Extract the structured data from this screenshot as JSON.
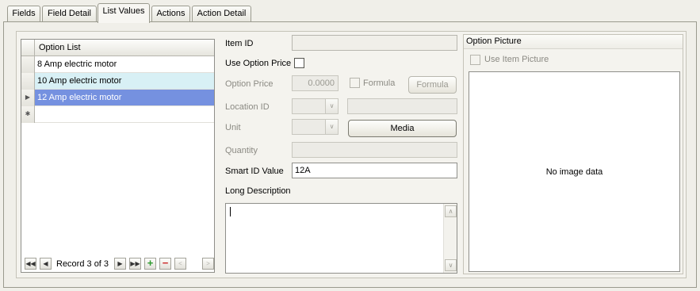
{
  "tabs": [
    {
      "label": "Fields"
    },
    {
      "label": "Field Detail"
    },
    {
      "label": "List Values"
    },
    {
      "label": "Actions"
    },
    {
      "label": "Action Detail"
    }
  ],
  "active_tab": "List Values",
  "grid": {
    "column_header": "Option List",
    "rows": [
      {
        "value": "8 Amp electric motor"
      },
      {
        "value": "10 Amp electric motor"
      },
      {
        "value": "12 Amp electric motor"
      }
    ],
    "selected_row": 3
  },
  "navigator": {
    "record_text": "Record 3 of 3"
  },
  "form": {
    "item_id_label": "Item ID",
    "item_id_value": "",
    "use_option_price_label": "Use Option Price",
    "use_option_price_checked": false,
    "option_price_label": "Option Price",
    "option_price_value": "0.0000",
    "formula_checkbox_label": "Formula",
    "formula_button_label": "Formula",
    "location_id_label": "Location ID",
    "location_id_value": "",
    "unit_label": "Unit",
    "media_button_label": "Media",
    "quantity_label": "Quantity",
    "quantity_value": "",
    "smart_id_label": "Smart ID Value",
    "smart_id_value": "12A",
    "long_description_label": "Long Description",
    "long_description_value": ""
  },
  "picture": {
    "header": "Option Picture",
    "use_item_picture_label": "Use Item Picture",
    "use_item_picture_checked": false,
    "placeholder": "No image data"
  },
  "icons": {
    "row_current": "triangle-right",
    "row_new": "asterisk",
    "nav_first": "first-record",
    "nav_prev": "previous-record",
    "nav_next": "next-record",
    "nav_last": "last-record",
    "nav_add": "plus",
    "nav_delete": "minus"
  },
  "colors": {
    "alt_row": "#d8f0f5",
    "selected_row": "#7591e0",
    "add_green": "#2e9a2e",
    "delete_red": "#cc2a2a"
  }
}
